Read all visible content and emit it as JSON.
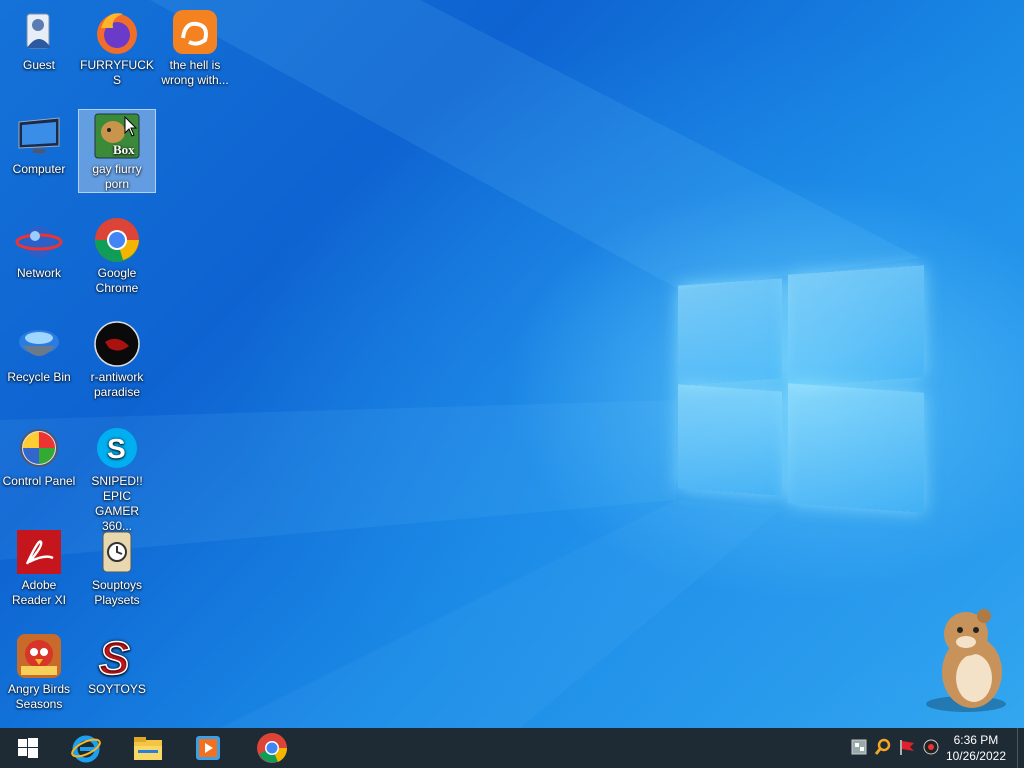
{
  "desktop": {
    "icons": [
      {
        "label": "Guest",
        "icon": "user-folder-icon"
      },
      {
        "label": "FURRYFUCKS",
        "icon": "firefox-icon"
      },
      {
        "label": "the hell is wrong with...",
        "icon": "uc-browser-icon"
      },
      {
        "label": "Computer",
        "icon": "computer-icon"
      },
      {
        "label": "gay fiurry porn",
        "icon": "box-app-icon",
        "selected": true
      },
      {
        "label": "Network",
        "icon": "network-icon"
      },
      {
        "label": "Google Chrome",
        "icon": "chrome-icon"
      },
      {
        "label": "Recycle Bin",
        "icon": "recycle-bin-icon"
      },
      {
        "label": "r-antiwork paradise",
        "icon": "antiwork-icon"
      },
      {
        "label": "Control Panel",
        "icon": "control-panel-icon"
      },
      {
        "label": "SNIPED!! EPIC GAMER 360...",
        "icon": "skype-icon"
      },
      {
        "label": "Adobe Reader XI",
        "icon": "adobe-reader-icon"
      },
      {
        "label": "Souptoys Playsets",
        "icon": "souptoys-icon"
      },
      {
        "label": "Angry Birds Seasons",
        "icon": "angry-birds-icon"
      },
      {
        "label": "SOYTOYS",
        "icon": "soytoys-icon"
      }
    ]
  },
  "taskbar": {
    "pinned": [
      {
        "icon": "windows-start-icon"
      },
      {
        "icon": "internet-explorer-icon"
      },
      {
        "icon": "file-explorer-icon"
      },
      {
        "icon": "media-player-icon"
      },
      {
        "icon": "chrome-icon"
      }
    ],
    "tray": [
      {
        "icon": "network-tray-icon"
      },
      {
        "icon": "search-tray-icon"
      },
      {
        "icon": "flag-tray-icon"
      },
      {
        "icon": "volume-tray-icon"
      }
    ],
    "clock": {
      "time": "6:36 PM",
      "date": "10/26/2022"
    }
  },
  "colors": {
    "taskbar": "#1e2a34",
    "desktop_accent": "#1572d8"
  }
}
